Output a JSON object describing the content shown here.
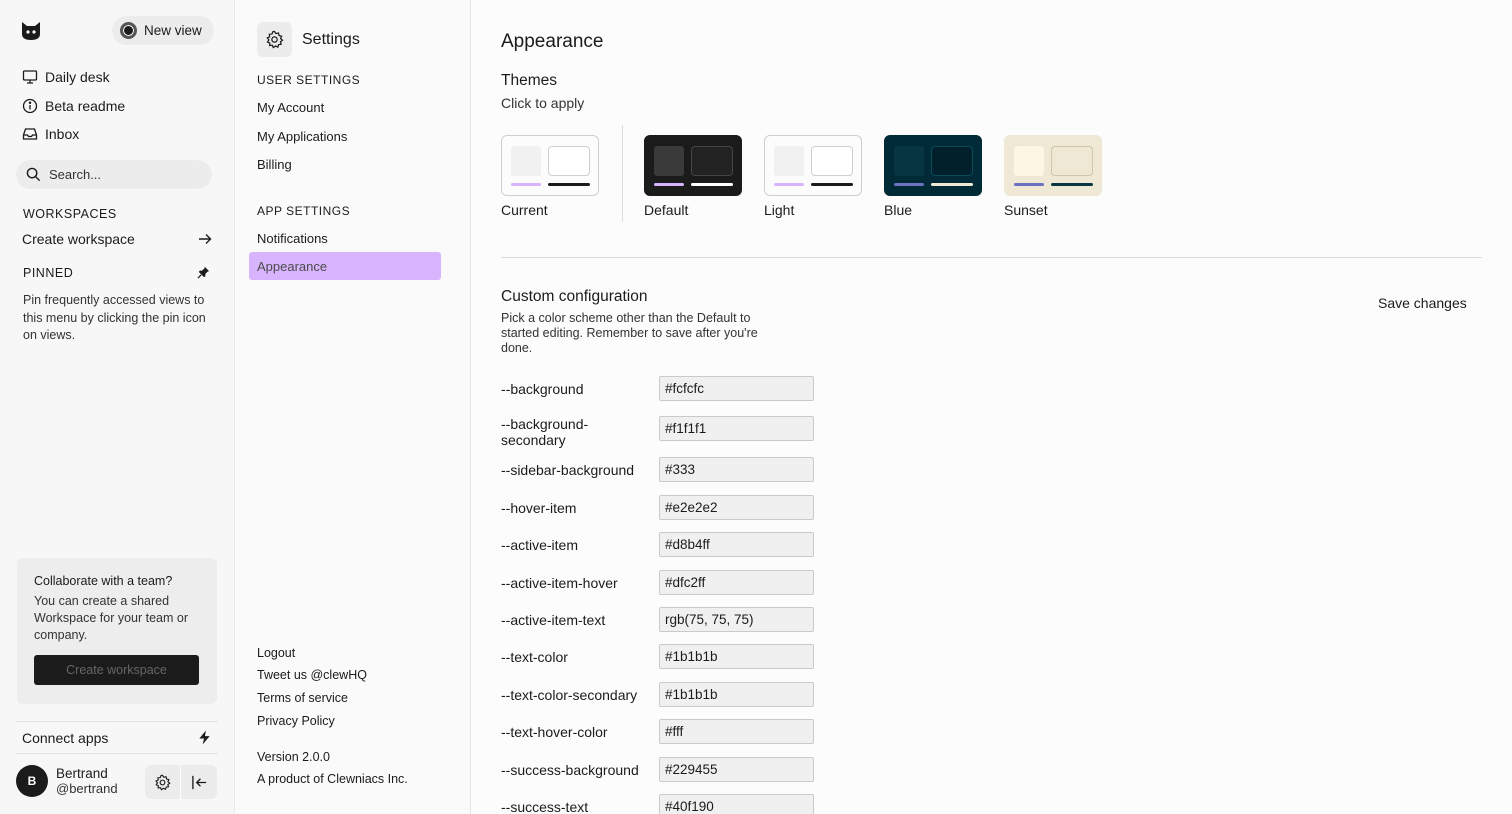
{
  "sidebar": {
    "new_view_label": "New view",
    "nav": [
      {
        "label": "Daily desk",
        "icon": "monitor-icon"
      },
      {
        "label": "Beta readme",
        "icon": "info-icon"
      },
      {
        "label": "Inbox",
        "icon": "inbox-icon"
      }
    ],
    "search_placeholder": "Search...",
    "workspaces_heading": "WORKSPACES",
    "create_workspace_link": "Create workspace",
    "pinned_heading": "PINNED",
    "pinned_text": "Pin frequently accessed views to this menu by clicking the pin icon on views.",
    "collab": {
      "title": "Collaborate with a team?",
      "text": "You can create a shared Workspace for your team or company.",
      "button": "Create workspace"
    },
    "connect_apps": "Connect apps",
    "user": {
      "initial": "B",
      "name": "Bertrand",
      "handle": "@bertrand"
    }
  },
  "settings_nav": {
    "title": "Settings",
    "user_settings_heading": "USER SETTINGS",
    "user_items": [
      "My Account",
      "My Applications",
      "Billing"
    ],
    "app_settings_heading": "APP SETTINGS",
    "app_items": [
      "Notifications",
      "Appearance"
    ],
    "active_item": "Appearance",
    "footer_links": [
      "Logout",
      "Tweet us @clewHQ",
      "Terms of service",
      "Privacy Policy"
    ],
    "version": "Version 2.0.0",
    "product": "A product of Clewniacs Inc."
  },
  "main": {
    "title": "Appearance",
    "themes_title": "Themes",
    "themes_subtitle": "Click to apply",
    "themes": [
      {
        "name": "Current",
        "card_bg": "#fcfcfc",
        "sw1": "#f1f1f1",
        "sw2": "#ffffff",
        "sw2_border": "#cfcfcf",
        "bar1": "#d8b4ff",
        "bar2": "#1b1b1b"
      },
      {
        "name": "Default",
        "card_bg": "#1b1b1b",
        "sw1": "#3a3a3a",
        "sw2": "#222222",
        "sw2_border": "#444444",
        "bar1": "#d8b4ff",
        "bar2": "#ffffff"
      },
      {
        "name": "Light",
        "card_bg": "#fcfcfc",
        "sw1": "#f1f1f1",
        "sw2": "#ffffff",
        "sw2_border": "#cfcfcf",
        "bar1": "#d8b4ff",
        "bar2": "#1b1b1b"
      },
      {
        "name": "Blue",
        "card_bg": "#002b36",
        "sw1": "#073642",
        "sw2": "#00212b",
        "sw2_border": "#0d4a57",
        "bar1": "#6c71c4",
        "bar2": "#eee8d5"
      },
      {
        "name": "Sunset",
        "card_bg": "#eee8d5",
        "sw1": "#fdf6e3",
        "sw2": "#eee8d5",
        "sw2_border": "#cfc6ab",
        "bar1": "#6c71c4",
        "bar2": "#073642"
      }
    ],
    "custom_title": "Custom configuration",
    "custom_desc": "Pick a color scheme other than the Default to started editing. Remember to save after you're done.",
    "save_changes": "Save changes",
    "variables": [
      {
        "name": "--background",
        "value": "#fcfcfc"
      },
      {
        "name": "--background-secondary",
        "value": "#f1f1f1"
      },
      {
        "name": "--sidebar-background",
        "value": "#333"
      },
      {
        "name": "--hover-item",
        "value": "#e2e2e2"
      },
      {
        "name": "--active-item",
        "value": "#d8b4ff"
      },
      {
        "name": "--active-item-hover",
        "value": "#dfc2ff"
      },
      {
        "name": "--active-item-text",
        "value": "rgb(75, 75, 75)"
      },
      {
        "name": "--text-color",
        "value": "#1b1b1b"
      },
      {
        "name": "--text-color-secondary",
        "value": "#1b1b1b"
      },
      {
        "name": "--text-hover-color",
        "value": "#fff"
      },
      {
        "name": "--success-background",
        "value": "#229455"
      },
      {
        "name": "--success-text",
        "value": "#40f190"
      }
    ]
  }
}
